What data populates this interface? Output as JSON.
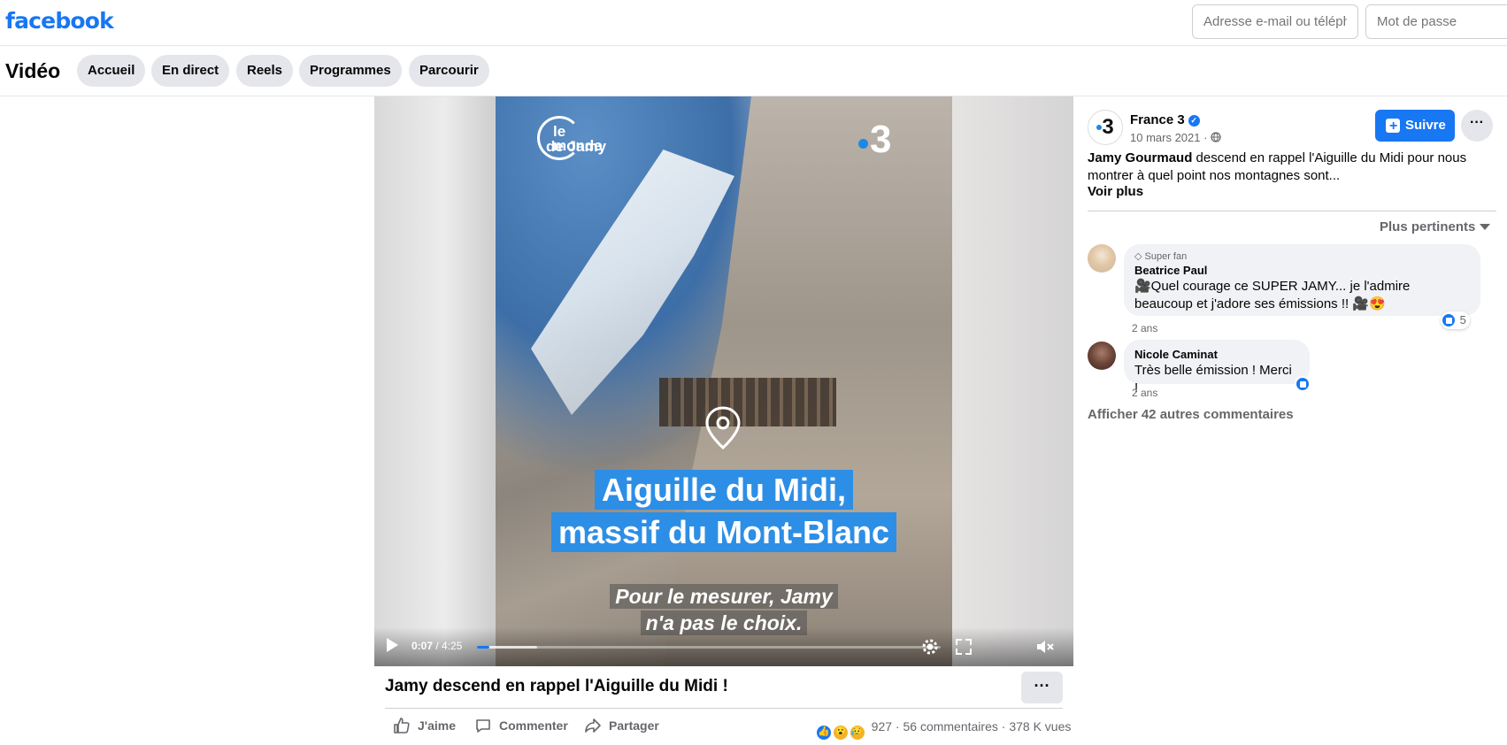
{
  "topbar": {
    "logo": "facebook",
    "email_placeholder": "Adresse e-mail ou téléphone",
    "password_placeholder": "Mot de passe"
  },
  "video_nav": {
    "title": "Vidéo",
    "tabs": [
      {
        "label": "Accueil"
      },
      {
        "label": "En direct"
      },
      {
        "label": "Reels"
      },
      {
        "label": "Programmes"
      },
      {
        "label": "Parcourir"
      }
    ]
  },
  "video": {
    "brand_left_line1": "le monde",
    "brand_left_line2": "de Jamy",
    "brand_right": "3",
    "caption_line1": "Aiguille du Midi,",
    "caption_line2": "massif du Mont-Blanc",
    "subtitle_line1": "Pour le mesurer, Jamy",
    "subtitle_line2": "n'a pas le choix.",
    "current_time": "0:07",
    "total_time": "/ 4:25",
    "progress": 0.026,
    "buffered": 0.13,
    "title": "Jamy descend en rappel l'Aiguille du Midi !",
    "more_label": "···",
    "actions": {
      "like": "J'aime",
      "comment": "Commenter",
      "share": "Partager"
    },
    "reaction_count": "927",
    "comment_count": "56 commentaires",
    "views": "378 K vues",
    "separator": "·"
  },
  "post": {
    "page_name": "France 3",
    "page_avatar": "3",
    "date": "10 mars 2021 ·",
    "follow_label": "Suivre",
    "more_label": "···",
    "author_bold": "Jamy Gourmaud",
    "description": " descend en rappel l'Aiguille du Midi pour nous montrer à quel point nos montagnes sont...",
    "see_more": "Voir plus",
    "sort_label": "Plus pertinents"
  },
  "comments": [
    {
      "badge": "Super fan",
      "name": "Beatrice Paul",
      "text": "🎥Quel courage ce SUPER JAMY... je l'admire beaucoup et j'adore ses émissions !! 🎥😍",
      "time": "2 ans",
      "reactions": "5"
    },
    {
      "name": "Nicole Caminat",
      "text": "Très belle émission ! Merci !",
      "time": "2 ans"
    }
  ],
  "show_more_comments": "Afficher 42 autres commentaires",
  "colors": {
    "brand": "#1877f2",
    "caption_bg": "#2d8ee6",
    "pill_bg": "#e4e6eb",
    "muted_text": "#65676b"
  }
}
